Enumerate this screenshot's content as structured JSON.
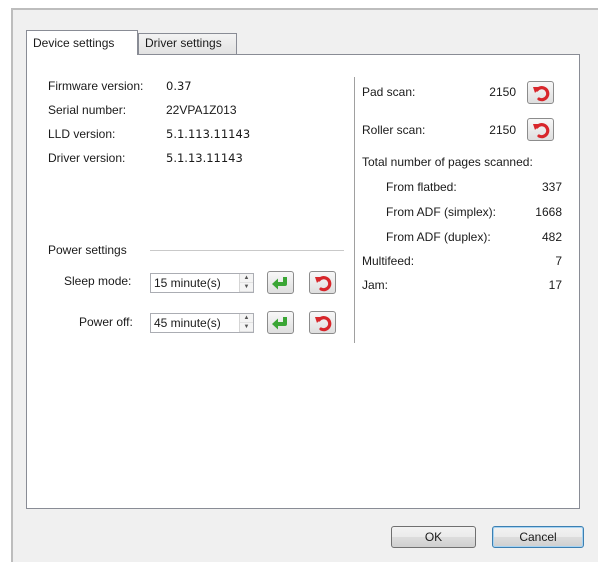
{
  "tabs": [
    {
      "label": "Device settings",
      "active": true
    },
    {
      "label": "Driver settings",
      "active": false
    }
  ],
  "device_info": {
    "firmware_label": "Firmware version:",
    "firmware_value": "0.37",
    "serial_label": "Serial number:",
    "serial_value": "22VPA1Z013",
    "lld_label": "LLD version:",
    "lld_value": "5.1.113.11143",
    "driver_label": "Driver version:",
    "driver_value": "5.1.13.11143"
  },
  "power_settings": {
    "group_label": "Power settings",
    "sleep_label": "Sleep mode:",
    "sleep_value": "15 minute(s)",
    "power_off_label": "Power off:",
    "power_off_value": "45 minute(s)"
  },
  "counters": {
    "pad_scan_label": "Pad scan:",
    "pad_scan_value": "2150",
    "roller_scan_label": "Roller scan:",
    "roller_scan_value": "2150",
    "total_label": "Total number of pages scanned:",
    "flatbed_label": "From flatbed:",
    "flatbed_value": "337",
    "adf_simplex_label": "From ADF (simplex):",
    "adf_simplex_value": "1668",
    "adf_duplex_label": "From ADF (duplex):",
    "adf_duplex_value": "482",
    "multifeed_label": "Multifeed:",
    "multifeed_value": "7",
    "jam_label": "Jam:",
    "jam_value": "17"
  },
  "buttons": {
    "ok": "OK",
    "cancel": "Cancel"
  },
  "icons": {
    "apply": "green-enter-arrow-icon",
    "reset": "red-undo-arrow-icon",
    "spin_up": "▲",
    "spin_down": "▼"
  },
  "colors": {
    "apply_green": "#3aa635",
    "reset_red": "#d8262b",
    "panel_border": "#898c95"
  }
}
